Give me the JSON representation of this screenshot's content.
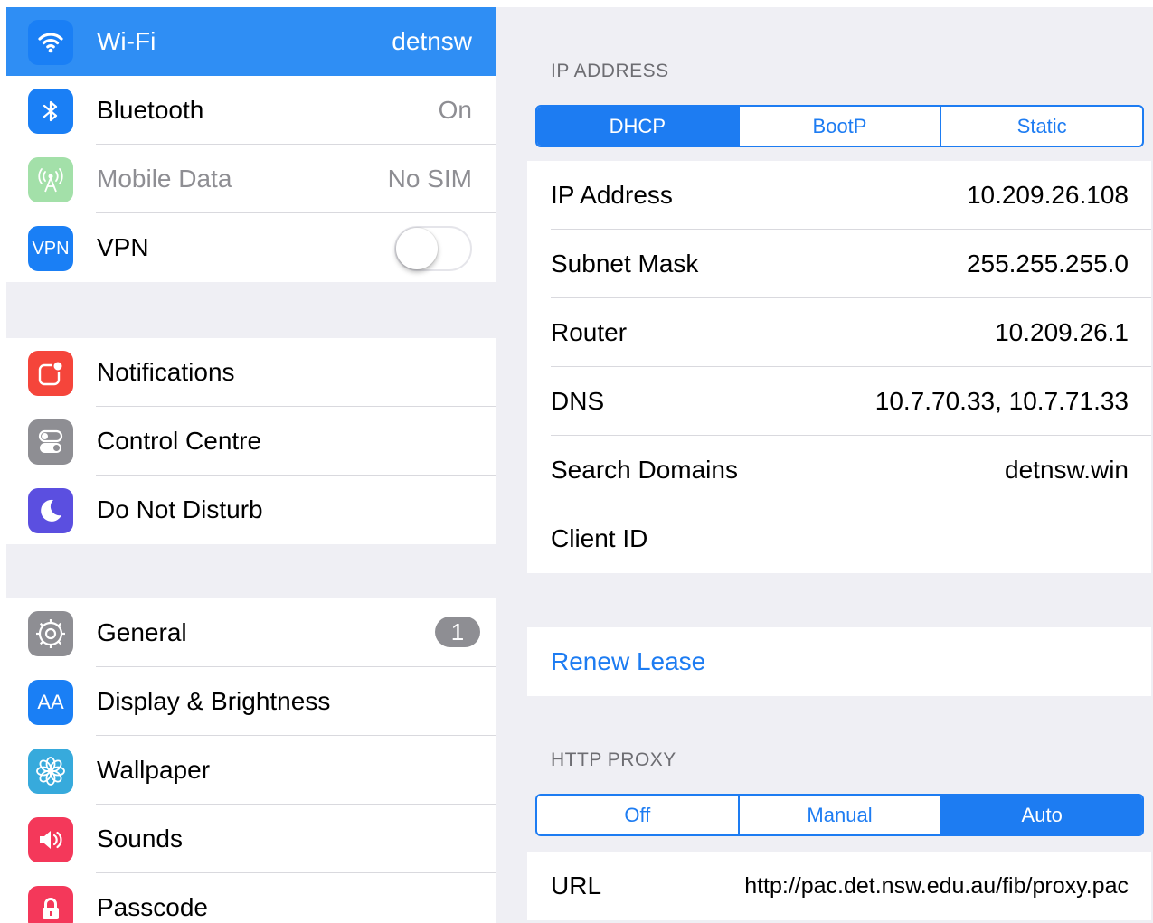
{
  "sidebar": {
    "groups": [
      [
        {
          "id": "wifi",
          "label": "Wi-Fi",
          "value": "detnsw",
          "icon": "wifi-icon",
          "color": "#1a7ff5",
          "selected": true
        },
        {
          "id": "bluetooth",
          "label": "Bluetooth",
          "value": "On",
          "icon": "bluetooth-icon",
          "color": "#1a7ff5"
        },
        {
          "id": "mobile-data",
          "label": "Mobile Data",
          "value": "No SIM",
          "icon": "antenna-icon",
          "color": "#a3e0a9",
          "dim": true
        },
        {
          "id": "vpn",
          "label": "VPN",
          "icon": "vpn-icon",
          "icon_text": "VPN",
          "color": "#1a7ff5",
          "toggle": false
        }
      ],
      [
        {
          "id": "notifications",
          "label": "Notifications",
          "icon": "notifications-icon",
          "color": "#f5453b"
        },
        {
          "id": "control-centre",
          "label": "Control Centre",
          "icon": "control-centre-icon",
          "color": "#8e8e93"
        },
        {
          "id": "do-not-disturb",
          "label": "Do Not Disturb",
          "icon": "moon-icon",
          "color": "#5b4fe0"
        }
      ],
      [
        {
          "id": "general",
          "label": "General",
          "badge": "1",
          "icon": "gear-icon",
          "color": "#8e8e93"
        },
        {
          "id": "display-brightness",
          "label": "Display & Brightness",
          "icon": "text-size-icon",
          "icon_text": "AA",
          "color": "#1a7ff5"
        },
        {
          "id": "wallpaper",
          "label": "Wallpaper",
          "icon": "flower-icon",
          "color": "#37aadc"
        },
        {
          "id": "sounds",
          "label": "Sounds",
          "icon": "speaker-icon",
          "color": "#f4385a"
        },
        {
          "id": "passcode",
          "label": "Passcode",
          "icon": "lock-icon",
          "color": "#f4385a"
        }
      ]
    ]
  },
  "detail": {
    "ip_section": {
      "header": "IP ADDRESS",
      "segments": [
        {
          "label": "DHCP",
          "active": true
        },
        {
          "label": "BootP",
          "active": false
        },
        {
          "label": "Static",
          "active": false
        }
      ],
      "rows": [
        {
          "label": "IP Address",
          "value": "10.209.26.108"
        },
        {
          "label": "Subnet Mask",
          "value": "255.255.255.0"
        },
        {
          "label": "Router",
          "value": "10.209.26.1"
        },
        {
          "label": "DNS",
          "value": "10.7.70.33, 10.7.71.33"
        },
        {
          "label": "Search Domains",
          "value": "detnsw.win"
        },
        {
          "label": "Client ID",
          "value": ""
        }
      ]
    },
    "renew_lease_label": "Renew Lease",
    "proxy_section": {
      "header": "HTTP PROXY",
      "segments": [
        {
          "label": "Off",
          "active": false
        },
        {
          "label": "Manual",
          "active": false
        },
        {
          "label": "Auto",
          "active": true
        }
      ],
      "rows": [
        {
          "label": "URL",
          "value": "http://pac.det.nsw.edu.au/fib/proxy.pac"
        }
      ]
    }
  },
  "colors": {
    "accent": "#1d7cf2",
    "selected_row": "#2f8ef4",
    "grouped_background": "#efeff4"
  }
}
